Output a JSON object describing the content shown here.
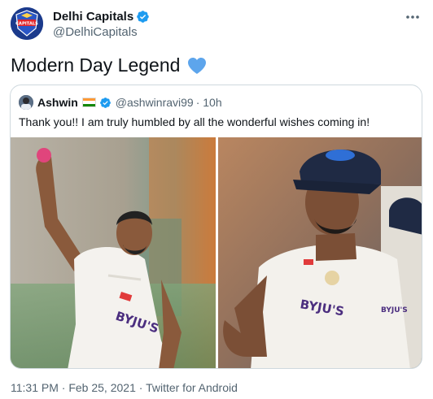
{
  "tweet": {
    "author": {
      "display_name": "Delhi Capitals",
      "handle": "@DelhiCapitals",
      "avatar_icon": "delhi-capitals-logo-icon"
    },
    "text": "Modern Day Legend",
    "emoji": "blue-heart-icon",
    "more_icon": "more-options-icon",
    "footer": {
      "time": "11:31 PM",
      "separator": "·",
      "date": "Feb 25, 2021",
      "source": "Twitter for Android"
    }
  },
  "quoted_tweet": {
    "author": {
      "display_name": "Ashwin",
      "handle": "@ashwinravi99",
      "flag": "india-flag-icon"
    },
    "time_ago": "· 10h",
    "text": "Thank you!! I am truly humbled by all the wonderful wishes coming in!",
    "photos": [
      {
        "name": "photo-ashwin-raising-pink-ball",
        "jersey_text": "BYJU'S"
      },
      {
        "name": "photo-ashwin-in-cap",
        "jersey_text": "BYJU'S"
      }
    ]
  },
  "colors": {
    "verified_blue": "#1d9bf0",
    "heart_blue": "#5da5ec",
    "secondary_text": "#536471",
    "border": "#cfd9de"
  }
}
